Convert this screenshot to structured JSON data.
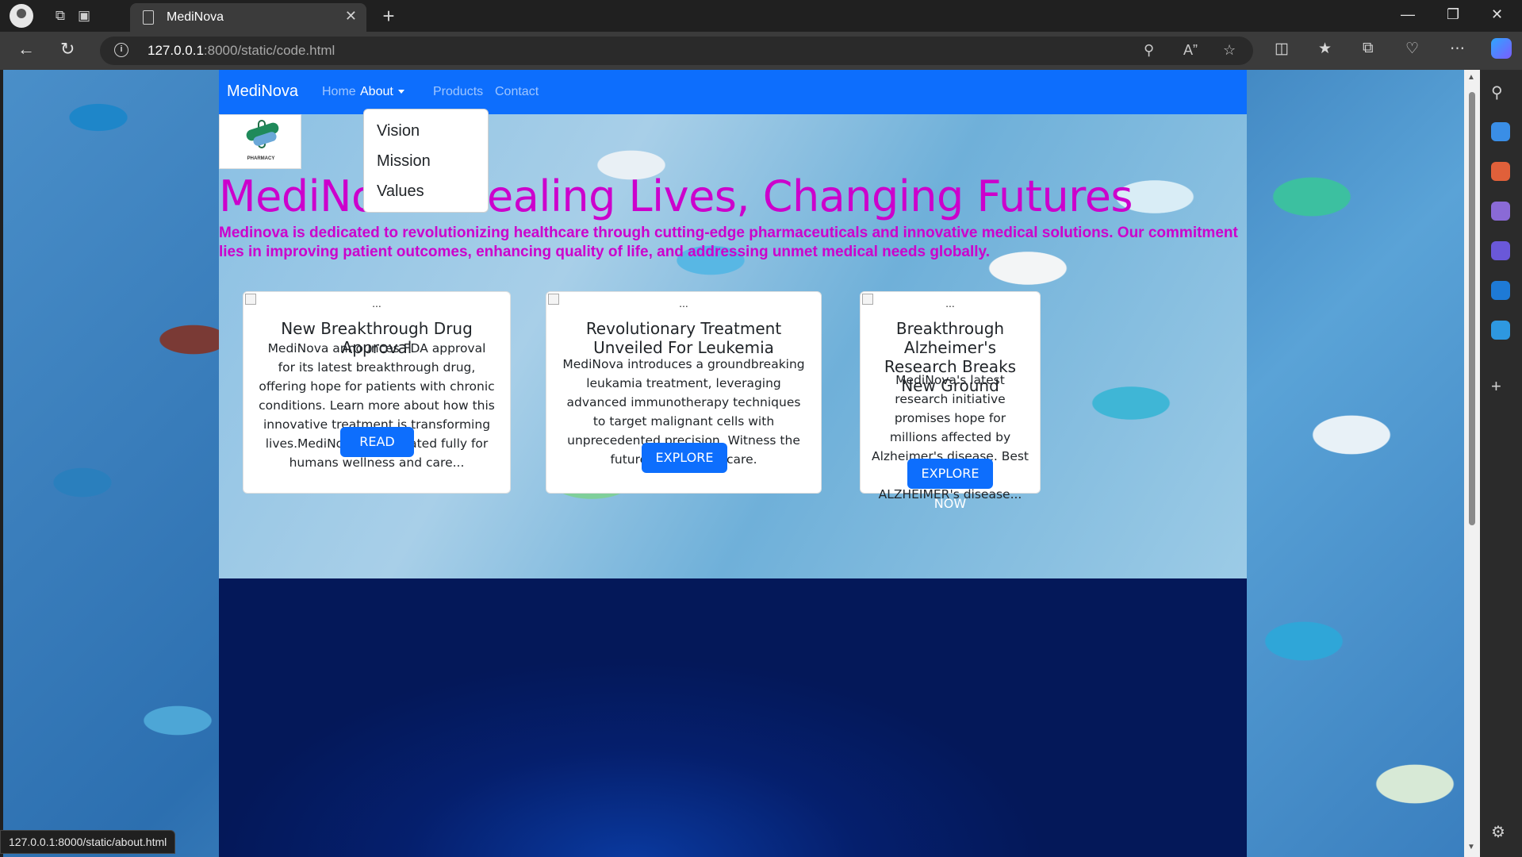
{
  "browser": {
    "tab_title": "MediNova",
    "url_host": "127.0.0.1",
    "url_rest": ":8000/static/code.html",
    "status_url": "127.0.0.1:8000/static/about.html"
  },
  "site": {
    "brand": "MediNova",
    "nav": [
      {
        "label": "Home"
      },
      {
        "label": "About"
      },
      {
        "label": "Products"
      },
      {
        "label": "Contact"
      }
    ],
    "dropdown": [
      "Vision",
      "Mission",
      "Values"
    ],
    "logo_text": "PHARMACY",
    "headline": "MediNova: Healing Lives, Changing Futures",
    "tagline": "Medinova is dedicated to revolutionizing healthcare through cutting-edge pharmaceuticals and innovative medical solutions. Our commitment lies in improving patient outcomes, enhancing quality of life, and addressing unmet medical needs globally.",
    "cards": [
      {
        "img_alt": "...",
        "title": "New Breakthrough Drug Approval",
        "text": "MediNova announces FDA approval for its latest breakthrough drug, offering hope for patients with chronic conditions. Learn more about how this innovative treatment is transforming lives.MediNova is dedicated fully for humans wellness and care...",
        "button": "READ MORE"
      },
      {
        "img_alt": "...",
        "title": "Revolutionary Treatment Unveiled For Leukemia",
        "text": "MediNova introduces a groundbreaking leukamia treatment, leveraging advanced immunotherapy techniques to target malignant cells with unprecedented precision. Witness the future of oncology care.",
        "button": "EXPLORE NOW"
      },
      {
        "img_alt": "...",
        "title": "Breakthrough Alzheimer's Research Breaks New Ground",
        "text": "MediNova's latest research initiative promises hope for millions affected by Alzheimer's disease. Best medicine for ALZHEIMER's disease...",
        "button": "EXPLORE NOW"
      }
    ]
  },
  "colors": {
    "navbar": "#0d6efd",
    "headline": "#cc00cc",
    "button": "#0d6efd",
    "dark_section": "#051f6d"
  },
  "icons": [
    "profile-icon",
    "workspaces-icon",
    "tab-actions-icon",
    "document-icon",
    "close-icon",
    "plus-icon",
    "back-icon",
    "refresh-icon",
    "info-icon",
    "zoom-icon",
    "read-aloud-icon",
    "favorite-star-icon",
    "split-screen-icon",
    "favorites-icon",
    "collections-icon",
    "browser-essentials-icon",
    "more-icon",
    "copilot-icon",
    "search-icon",
    "gear-icon"
  ]
}
